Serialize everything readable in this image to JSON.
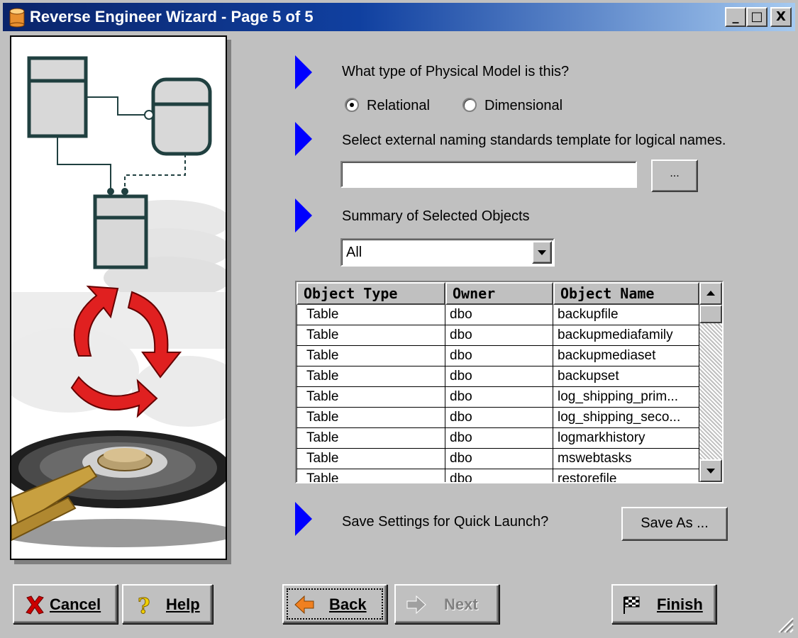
{
  "window": {
    "title": "Reverse Engineer Wizard - Page 5 of 5",
    "controls": {
      "minimize": "_",
      "maximize": "□",
      "close": "X"
    }
  },
  "model_type": {
    "prompt": "What type of Physical Model is this?",
    "options": [
      {
        "label": "Relational",
        "checked": true
      },
      {
        "label": "Dimensional",
        "checked": false
      }
    ]
  },
  "naming_standards": {
    "prompt": "Select external naming standards template for logical names.",
    "value": "",
    "browse_label": "..."
  },
  "summary": {
    "prompt": "Summary of Selected Objects",
    "filter": "All",
    "columns": [
      "Object Type",
      "Owner",
      "Object Name"
    ],
    "rows": [
      [
        "Table",
        "dbo",
        "backupfile"
      ],
      [
        "Table",
        "dbo",
        "backupmediafamily"
      ],
      [
        "Table",
        "dbo",
        "backupmediaset"
      ],
      [
        "Table",
        "dbo",
        "backupset"
      ],
      [
        "Table",
        "dbo",
        "log_shipping_prim..."
      ],
      [
        "Table",
        "dbo",
        "log_shipping_seco..."
      ],
      [
        "Table",
        "dbo",
        "logmarkhistory"
      ],
      [
        "Table",
        "dbo",
        "mswebtasks"
      ],
      [
        "Table",
        "dbo",
        "restorefile"
      ]
    ]
  },
  "quick_launch": {
    "prompt": "Save Settings for Quick Launch?",
    "save_as_label": "Save As ..."
  },
  "buttons": {
    "cancel": "Cancel",
    "help": "Help",
    "back": "Back",
    "next": "Next",
    "finish": "Finish"
  },
  "icons": {
    "app": "database-cylinder-icon",
    "cancel": "red-x-icon",
    "help": "question-mark-icon",
    "back": "left-arrow-icon",
    "next": "right-arrow-icon",
    "finish": "checkered-flag-icon",
    "step": "blue-triangle-icon"
  },
  "colors": {
    "face": "#c0c0c0",
    "title_start": "#0a246a",
    "title_end": "#a6caf0",
    "step_arrow": "#0000ff",
    "cancel_x": "#cc0000",
    "back_arrow": "#f08020"
  }
}
